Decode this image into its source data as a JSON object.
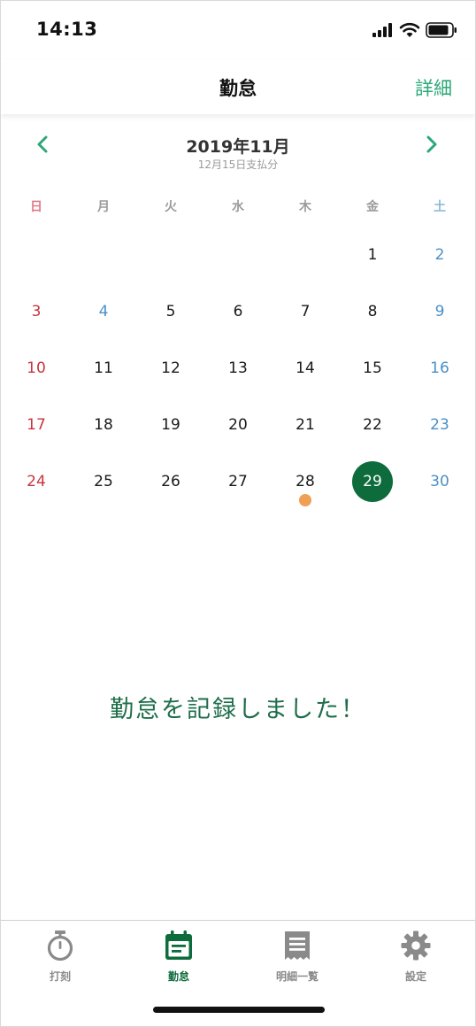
{
  "status_bar": {
    "time": "14:13"
  },
  "header": {
    "title": "勤怠",
    "detail_label": "詳細"
  },
  "calendar": {
    "month_title": "2019年11月",
    "payment_note": "12月15日支払分",
    "weekdays": [
      "日",
      "月",
      "火",
      "水",
      "木",
      "金",
      "土"
    ],
    "weeks": [
      [
        "",
        "",
        "",
        "",
        "",
        "1",
        "2"
      ],
      [
        "3",
        "4",
        "5",
        "6",
        "7",
        "8",
        "9"
      ],
      [
        "10",
        "11",
        "12",
        "13",
        "14",
        "15",
        "16"
      ],
      [
        "17",
        "18",
        "19",
        "20",
        "21",
        "22",
        "23"
      ],
      [
        "24",
        "25",
        "26",
        "27",
        "28",
        "29",
        "30"
      ]
    ],
    "selected_day": "29",
    "marked_days": [
      "28"
    ],
    "colors": {
      "accent": "#2aa876",
      "selected": "#0d6b3c",
      "sunday": "#c8343f",
      "saturday": "#4a90c8",
      "marker": "#f0a055"
    }
  },
  "message": "勤怠を記録しました！",
  "tabs": [
    {
      "label": "打刻",
      "icon": "stopwatch-icon",
      "active": false
    },
    {
      "label": "勤怠",
      "icon": "calendar-icon",
      "active": true
    },
    {
      "label": "明細一覧",
      "icon": "receipt-icon",
      "active": false
    },
    {
      "label": "設定",
      "icon": "gear-icon",
      "active": false
    }
  ]
}
